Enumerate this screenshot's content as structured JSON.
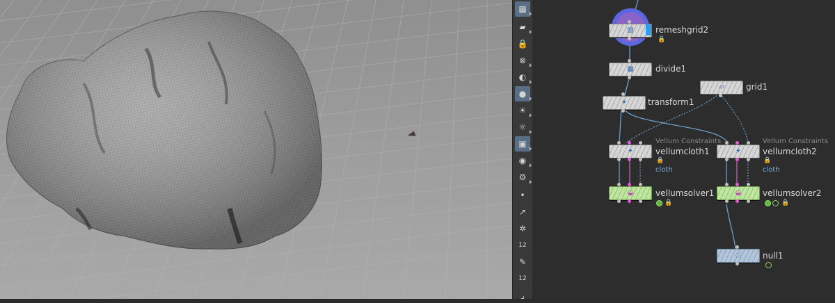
{
  "viewport": {
    "name": "3d-viewport",
    "status_text": ""
  },
  "toolbar": {
    "icons": [
      {
        "name": "select-mode-icon",
        "glyph": "▦",
        "active": true,
        "sub": true
      },
      {
        "name": "pose-tool-icon",
        "glyph": "▰",
        "active": false,
        "sub": true
      },
      {
        "name": "lock-icon",
        "glyph": "🔒",
        "active": false,
        "sub": false
      },
      {
        "name": "ghost-icon",
        "glyph": "⊗",
        "active": false,
        "sub": true
      },
      {
        "name": "shading-icon",
        "glyph": "◐",
        "active": false,
        "sub": true
      },
      {
        "name": "light-icon",
        "glyph": "●",
        "active": true,
        "sub": true
      },
      {
        "name": "headlight-icon",
        "glyph": "☀",
        "active": false,
        "sub": true
      },
      {
        "name": "camera-light-icon",
        "glyph": "☼",
        "active": false,
        "sub": true
      },
      {
        "name": "background-icon",
        "glyph": "▣",
        "active": true,
        "sub": true
      },
      {
        "name": "visibility-icon",
        "glyph": "◉",
        "active": false,
        "sub": true
      },
      {
        "name": "display-options-icon",
        "glyph": "⚙",
        "active": false,
        "sub": true
      },
      {
        "name": "point-icon",
        "glyph": "•",
        "active": false,
        "sub": false
      },
      {
        "name": "normal-icon",
        "glyph": "↗",
        "active": false,
        "sub": false
      },
      {
        "name": "pin-icon",
        "glyph": "✲",
        "active": false,
        "sub": false
      },
      {
        "name": "point-numbers-icon",
        "glyph": "12",
        "active": false,
        "sub": false
      },
      {
        "name": "paint-icon",
        "glyph": "✎",
        "active": false,
        "sub": false
      },
      {
        "name": "prim-numbers-icon",
        "glyph": "12",
        "active": false,
        "sub": false
      },
      {
        "name": "corner-icon",
        "glyph": "⌟",
        "active": false,
        "sub": false
      }
    ]
  },
  "network": {
    "nodes": [
      {
        "id": "remeshgrid2",
        "label": "remeshgrid2",
        "type": "",
        "group": "",
        "color": "grey",
        "icon": "▧",
        "icon_name": "remesh-icon",
        "flag": true,
        "lock": true,
        "badges": []
      },
      {
        "id": "divide1",
        "label": "divide1",
        "type": "",
        "group": "",
        "color": "grey",
        "icon": "▩",
        "icon_name": "divide-icon",
        "flag": false,
        "lock": false,
        "badges": []
      },
      {
        "id": "grid1",
        "label": "grid1",
        "type": "",
        "group": "",
        "color": "grey",
        "icon": "▱",
        "icon_name": "grid-icon",
        "flag": false,
        "lock": false,
        "badges": []
      },
      {
        "id": "transform1",
        "label": "transform1",
        "type": "",
        "group": "",
        "color": "grey",
        "icon": "✦",
        "icon_name": "transform-icon",
        "flag": false,
        "lock": false,
        "badges": []
      },
      {
        "id": "vellumcloth1",
        "label": "vellumcloth1",
        "type": "Vellum Constraints",
        "group": "cloth",
        "color": "grey",
        "icon": "✦",
        "icon_name": "vellum-constraints-icon",
        "flag": false,
        "lock": true,
        "badges": []
      },
      {
        "id": "vellumcloth2",
        "label": "vellumcloth2",
        "type": "Vellum Constraints",
        "group": "cloth",
        "color": "grey",
        "icon": "✦",
        "icon_name": "vellum-constraints-icon",
        "flag": false,
        "lock": true,
        "badges": []
      },
      {
        "id": "vellumsolver1",
        "label": "vellumsolver1",
        "type": "",
        "group": "",
        "color": "green",
        "icon": "◒",
        "icon_name": "vellum-solver-icon",
        "flag": false,
        "lock": true,
        "badges": [
          "fill"
        ]
      },
      {
        "id": "vellumsolver2",
        "label": "vellumsolver2",
        "type": "",
        "group": "",
        "color": "green",
        "icon": "◒",
        "icon_name": "vellum-solver-icon",
        "flag": false,
        "lock": true,
        "badges": [
          "fill",
          "ring"
        ]
      },
      {
        "id": "null1",
        "label": "null1",
        "type": "",
        "group": "",
        "color": "blue",
        "icon": "◌",
        "icon_name": "null-icon",
        "flag": false,
        "lock": false,
        "badges": [
          "ring"
        ]
      }
    ]
  },
  "colors": {
    "display_flag": "#2e9cf0",
    "selection_ring": "#6b6ee6",
    "solver_node": "#bfe5a0",
    "null_node": "#b3c6d9",
    "group_text": "#6aaef0",
    "wire": "#6d9ec8",
    "pink_port": "#e05ad8"
  }
}
